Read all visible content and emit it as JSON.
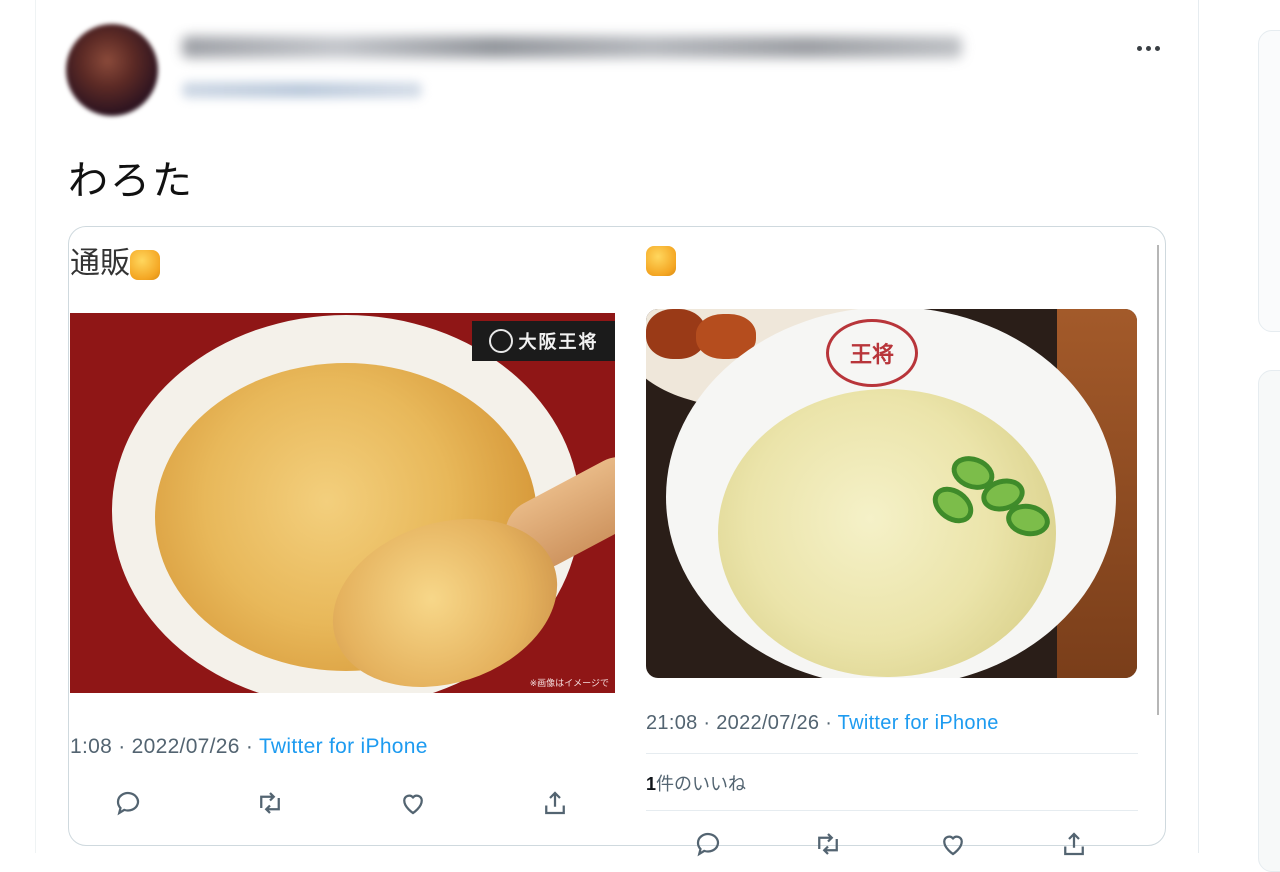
{
  "tweet": {
    "author_name": "",
    "author_handle": "",
    "text": "わろた",
    "more_label": "More"
  },
  "quote_left": {
    "caption": "通販",
    "caption_emoji": "thumbs-up-emoji",
    "image_logo_text": "大阪王将",
    "image_note": "※画像はイメージで",
    "time": "1:08",
    "date": "2022/07/26",
    "source": "Twitter for iPhone",
    "actions": [
      "reply-icon",
      "retweet-icon",
      "like-icon",
      "share-icon"
    ]
  },
  "quote_right": {
    "caption_emoji": "thumbs-up-emoji",
    "bowl_stamp_text": "王将",
    "time": "21:08",
    "date": "2022/07/26",
    "source": "Twitter for iPhone",
    "likes_count": "1",
    "likes_label": "件のいいね",
    "actions": [
      "reply-icon",
      "retweet-icon",
      "like-icon",
      "share-icon"
    ]
  },
  "colors": {
    "link": "#1d9bf0",
    "meta": "#536471",
    "border": "#cfd9de"
  }
}
